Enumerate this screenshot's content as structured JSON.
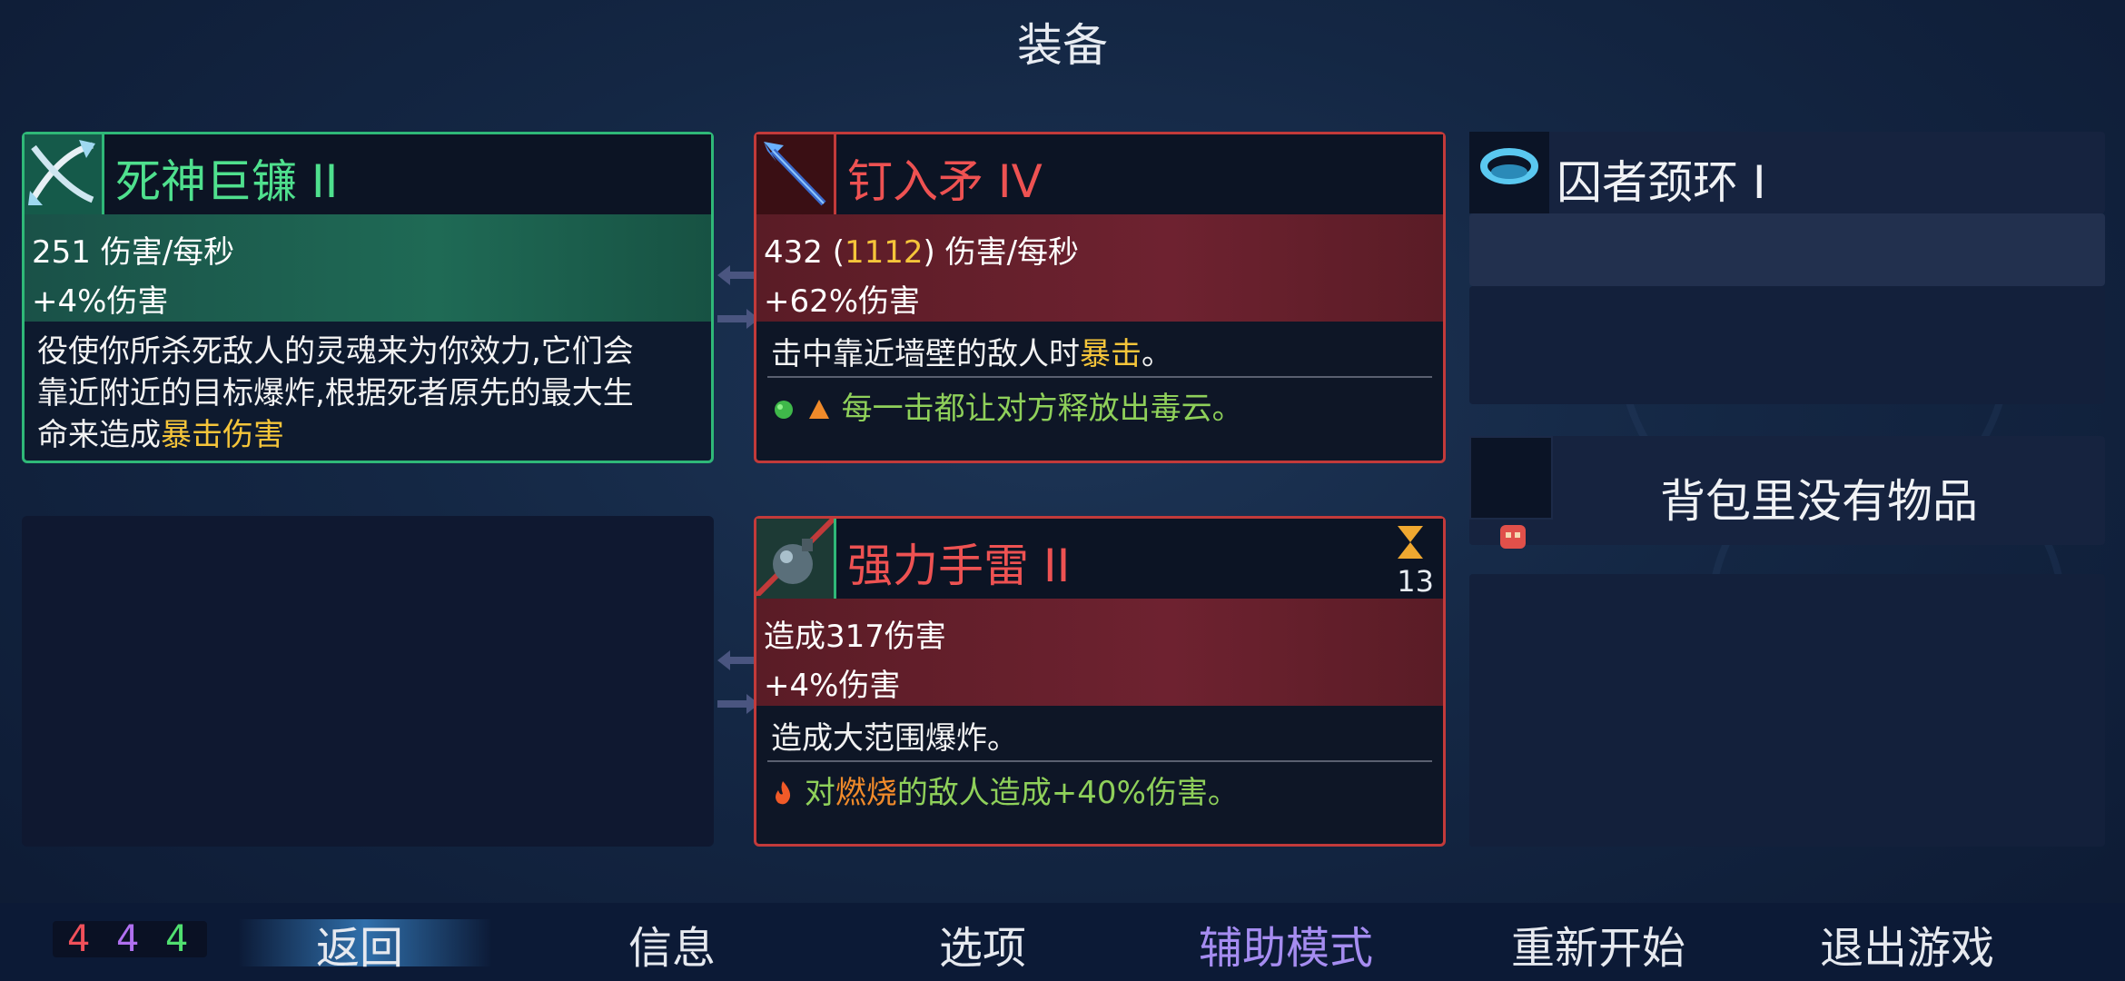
{
  "screen_title": "装备",
  "colors": {
    "accent_green": "#2fb878",
    "accent_red": "#c23a3a",
    "highlight": "#f5c53a",
    "assist_mode": "#a58cf0"
  },
  "weapon1": {
    "icon": "scythe-icon",
    "name": "死神巨镰 II",
    "dps": "251 伤害/每秒",
    "bonus": "+4%伤害",
    "desc_lines": [
      "役使你所杀死敌人的灵魂来为你效力,它们会",
      "靠近附近的目标爆炸,根据死者原先的最大生",
      "命来造成"
    ],
    "desc_highlight": "暴击伤害"
  },
  "weapon2": {
    "icon": "spear-icon",
    "name": "钉入矛 IV",
    "dps_prefix": "432 (",
    "dps_crit": "1112",
    "dps_suffix": ") 伤害/每秒",
    "bonus": "+62%伤害",
    "desc_text": "击中靠近墙壁的敌人时",
    "desc_highlight": "暴击",
    "desc_end": "。",
    "affix": "每一击都让对方释放出毒云。"
  },
  "skill1": {
    "icon": "grenade-icon",
    "name": "强力手雷 II",
    "cooldown": "13",
    "damage": "造成317伤害",
    "bonus": "+4%伤害",
    "desc": "造成大范围爆炸。",
    "affix_prefix": "对",
    "affix_highlight": "燃烧",
    "affix_suffix": "的敌人造成+40%伤害。"
  },
  "amulet": {
    "icon": "amulet-icon",
    "name": "囚者颈环 I"
  },
  "backpack": {
    "icon": "backpack-icon",
    "label": "背包里没有物品"
  },
  "scrolls": {
    "brutality": "4",
    "tactics": "4",
    "survival": "4"
  },
  "menu": {
    "back": "返回",
    "info": "信息",
    "options": "选项",
    "assist": "辅助模式",
    "restart": "重新开始",
    "quit": "退出游戏"
  }
}
